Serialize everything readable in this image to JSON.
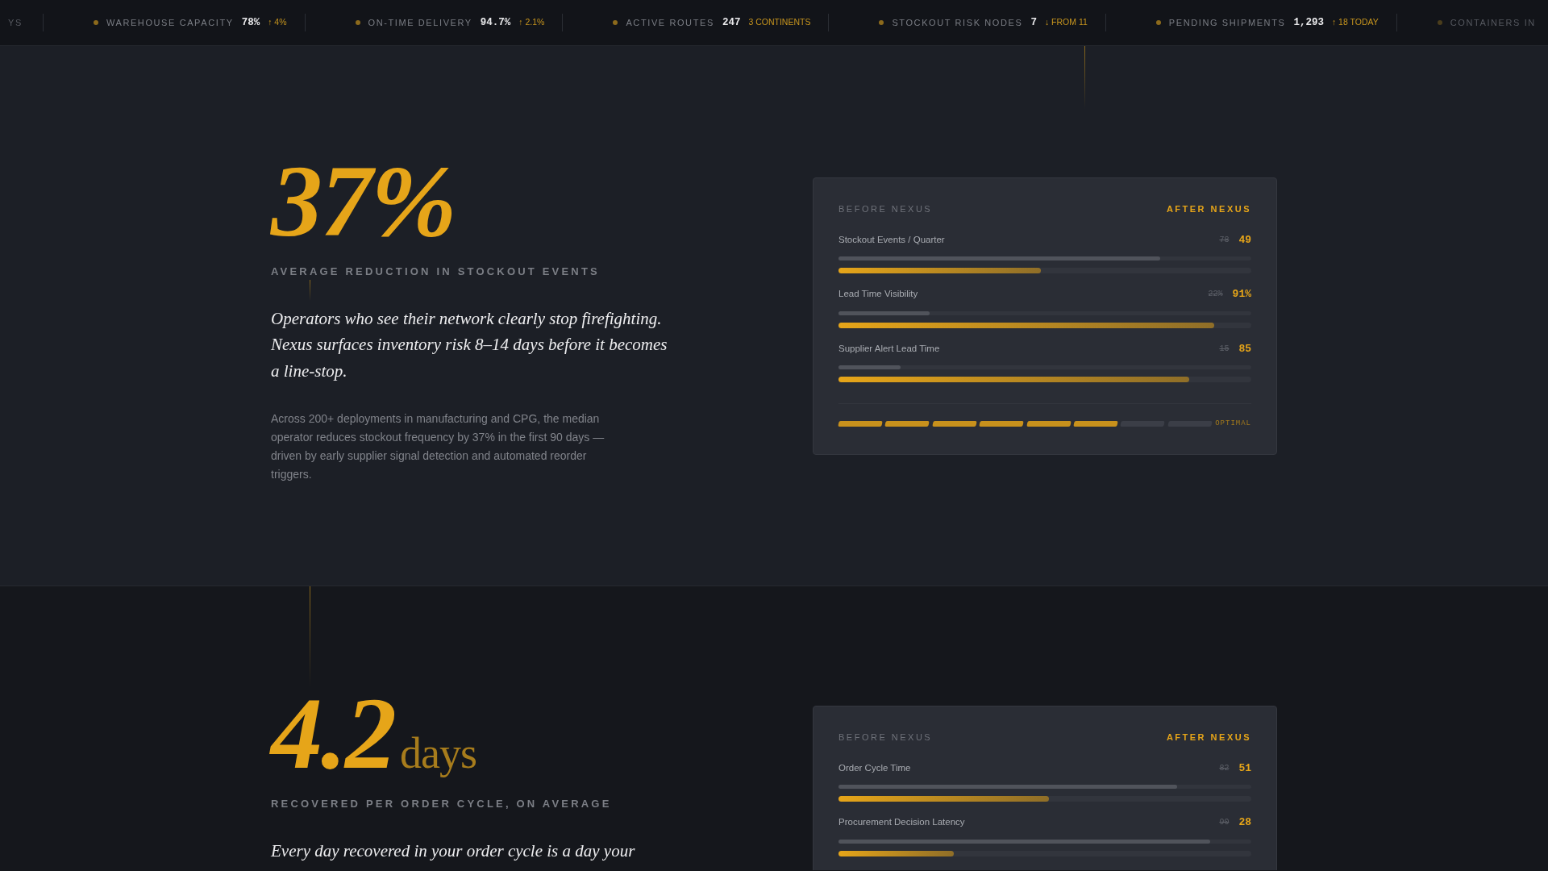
{
  "ticker": [
    {
      "label": "YS",
      "faded": true
    },
    {
      "label": "WAREHOUSE CAPACITY",
      "value": "78%",
      "delta": "↑ 4%"
    },
    {
      "label": "ON-TIME DELIVERY",
      "value": "94.7%",
      "delta": "↑ 2.1%"
    },
    {
      "label": "ACTIVE ROUTES",
      "value": "247",
      "delta": "3 CONTINENTS"
    },
    {
      "label": "STOCKOUT RISK NODES",
      "value": "7",
      "delta": "↓ FROM 11"
    },
    {
      "label": "PENDING SHIPMENTS",
      "value": "1,293",
      "delta": "↑ 18 TODAY"
    },
    {
      "label": "CONTAINERS IN",
      "faded": true
    }
  ],
  "sections": [
    {
      "stat": "37%",
      "caption": "AVERAGE REDUCTION IN STOCKOUT EVENTS",
      "lead": "Operators who see their network clearly stop firefighting. Nexus surfaces inventory risk 8–14 days before it becomes a line-stop.",
      "body": "Across 200+ deployments in manufacturing and CPG, the median operator reduces stockout frequency by 37% in the first 90 days — driven by early supplier signal detection and automated reorder triggers.",
      "card": {
        "before_heading": "BEFORE NEXUS",
        "after_heading": "AFTER NEXUS",
        "metrics": [
          {
            "label": "Stockout Events / Quarter",
            "before": "78",
            "after": "49",
            "before_level": {
              "level": 0.78
            },
            "after_level": {
              "level": 0.49
            }
          },
          {
            "label": "Lead Time Visibility",
            "before": "22%",
            "after": "91%",
            "before_level": {
              "level": 0.22
            },
            "after_level": {
              "level": 0.91
            }
          },
          {
            "label": "Supplier Alert Lead Time",
            "before": "15",
            "after": "85",
            "before_level": {
              "level": 0.15
            },
            "after_level": {
              "level": 0.85
            }
          }
        ],
        "segments": [
          {
            "on": true
          },
          {
            "on": true
          },
          {
            "on": true
          },
          {
            "on": true
          },
          {
            "on": true
          },
          {
            "on": true
          },
          {
            "on": false
          },
          {
            "on": false
          }
        ],
        "segment_label": "OPTIMAL"
      }
    },
    {
      "stat": "4.2",
      "unit": "days",
      "caption": "RECOVERED PER ORDER CYCLE, ON AVERAGE",
      "lead": "Every day recovered in your order cycle is a day your",
      "card": {
        "before_heading": "BEFORE NEXUS",
        "after_heading": "AFTER NEXUS",
        "metrics": [
          {
            "label": "Order Cycle Time",
            "before": "82",
            "after": "51",
            "before_level": {
              "level": 0.82
            },
            "after_level": {
              "level": 0.51
            }
          },
          {
            "label": "Procurement Decision Latency",
            "before": "90",
            "after": "28",
            "before_level": {
              "level": 0.9
            },
            "after_level": {
              "level": 0.28
            }
          }
        ]
      }
    }
  ]
}
